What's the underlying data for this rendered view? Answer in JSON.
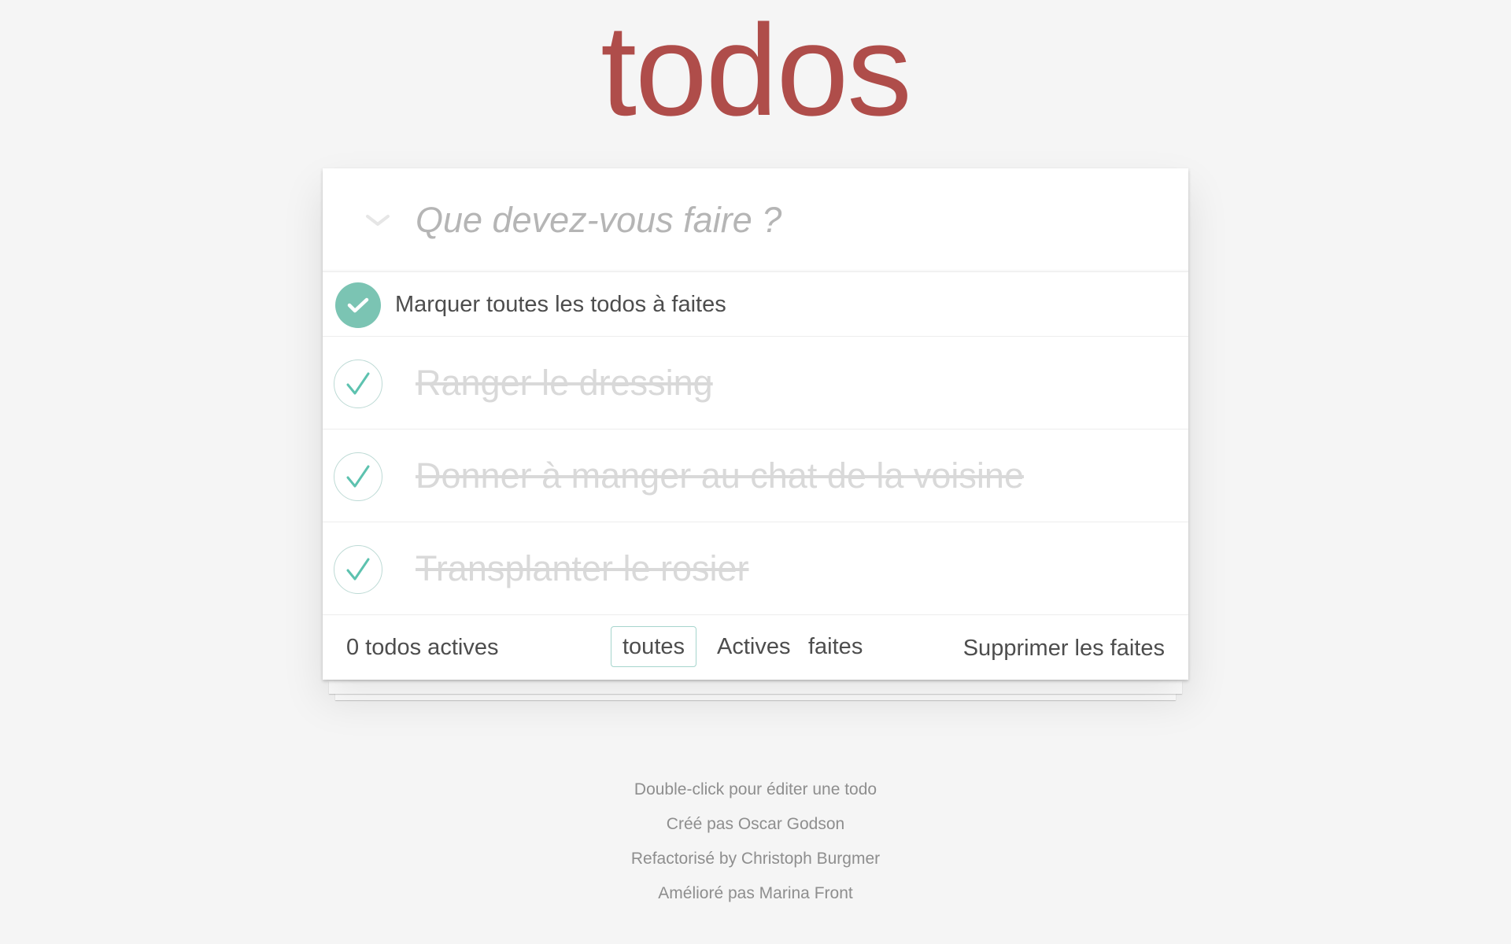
{
  "app": {
    "title": "todos"
  },
  "new_todo": {
    "placeholder": "Que devez-vous faire ?"
  },
  "mark_all": {
    "label": "Marquer toutes les todos à faites",
    "checked": true
  },
  "todos": [
    {
      "label": "Ranger le dressing",
      "completed": true
    },
    {
      "label": "Donner à manger au chat de la voisine",
      "completed": true
    },
    {
      "label": "Transplanter le rosier",
      "completed": true
    }
  ],
  "footer": {
    "count": "0 todos actives",
    "filters": [
      {
        "label": "toutes",
        "selected": true
      },
      {
        "label": "Actives",
        "selected": false
      },
      {
        "label": "faites",
        "selected": false
      }
    ],
    "clear_completed": "Supprimer les faites"
  },
  "info": [
    "Double-click pour éditer une todo",
    "Créé pas Oscar Godson",
    "Refactorisé by Christoph Burgmer",
    "Amélioré pas Marina Front"
  ],
  "colors": {
    "title": "#af4d4a",
    "accent": "#7bc4b3",
    "completed_text": "#d9d9d9",
    "background": "#f5f5f5"
  },
  "icons": {
    "toggle_all": "chevron-down-icon",
    "mark_all": "check-circle-filled-icon",
    "todo_done": "checkmark-icon"
  }
}
